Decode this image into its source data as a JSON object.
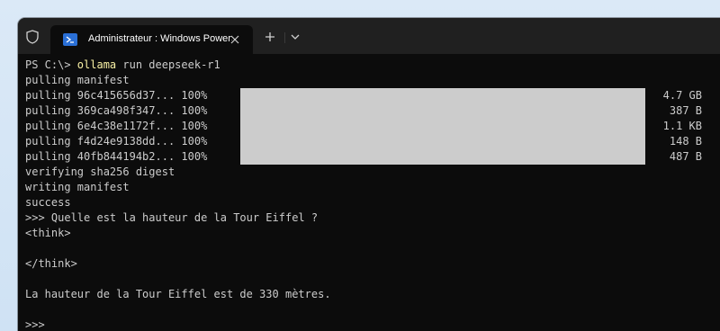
{
  "tab": {
    "title": "Administrateur : Windows PowerShell"
  },
  "terminal": {
    "prompt": "PS C:\\> ",
    "command": "ollama",
    "args": " run deepseek-r1",
    "pulling_manifest": "pulling manifest",
    "pulls": [
      {
        "text": "pulling 96c415656d37... 100%",
        "size": "4.7 GB",
        "progress": 1.0
      },
      {
        "text": "pulling 369ca498f347... 100%",
        "size": "387 B",
        "progress": 1.0
      },
      {
        "text": "pulling 6e4c38e1172f... 100%",
        "size": "1.1 KB",
        "progress": 1.0
      },
      {
        "text": "pulling f4d24e9138dd... 100%",
        "size": "148 B",
        "progress": 1.0
      },
      {
        "text": "pulling 40fb844194b2... 100%",
        "size": "487 B",
        "progress": 1.0
      }
    ],
    "verifying": "verifying sha256 digest",
    "writing": "writing manifest",
    "success": "success",
    "question": ">>> Quelle est la hauteur de la Tour Eiffel ?",
    "think_open": "<think>",
    "think_close": "</think>",
    "answer": "La hauteur de la Tour Eiffel est de 330 mètres.",
    "next_prompt": ">>>"
  },
  "colors": {
    "terminal_bg": "#0c0c0c",
    "text": "#cccccc",
    "command": "#f9f1a5",
    "progress_bar": "#cccccc",
    "ps_icon": "#2a6fd6"
  }
}
